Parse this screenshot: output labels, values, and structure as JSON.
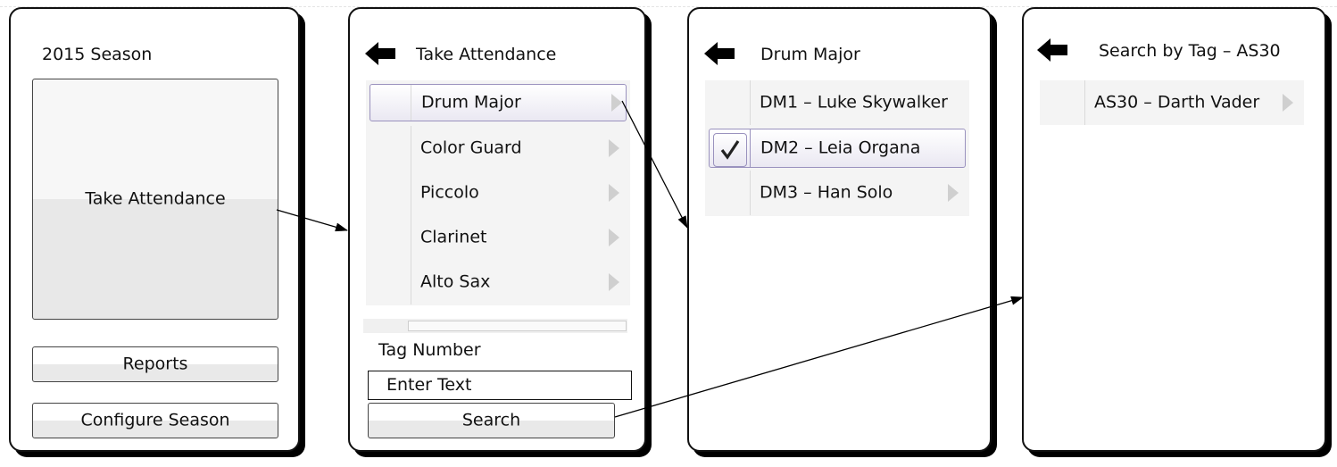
{
  "screen1": {
    "title": "2015 Season",
    "take_attendance_label": "Take Attendance",
    "reports_label": "Reports",
    "configure_label": "Configure Season"
  },
  "screen2": {
    "title": "Take Attendance",
    "sections": [
      "Drum Major",
      "Color Guard",
      "Piccolo",
      "Clarinet",
      "Alto Sax"
    ],
    "tag_label": "Tag Number",
    "tag_placeholder": "Enter Text",
    "search_label": "Search"
  },
  "screen3": {
    "title": "Drum Major",
    "members": [
      "DM1 – Luke Skywalker",
      "DM2 – Leia Organa",
      "DM3 – Han Solo"
    ]
  },
  "screen4": {
    "title": "Search by Tag – AS30",
    "result": "AS30 – Darth Vader"
  },
  "colors": {
    "selection_border": "#9a92be",
    "list_background": "#f4f4f4",
    "button_shade": "#e9e9e9"
  }
}
